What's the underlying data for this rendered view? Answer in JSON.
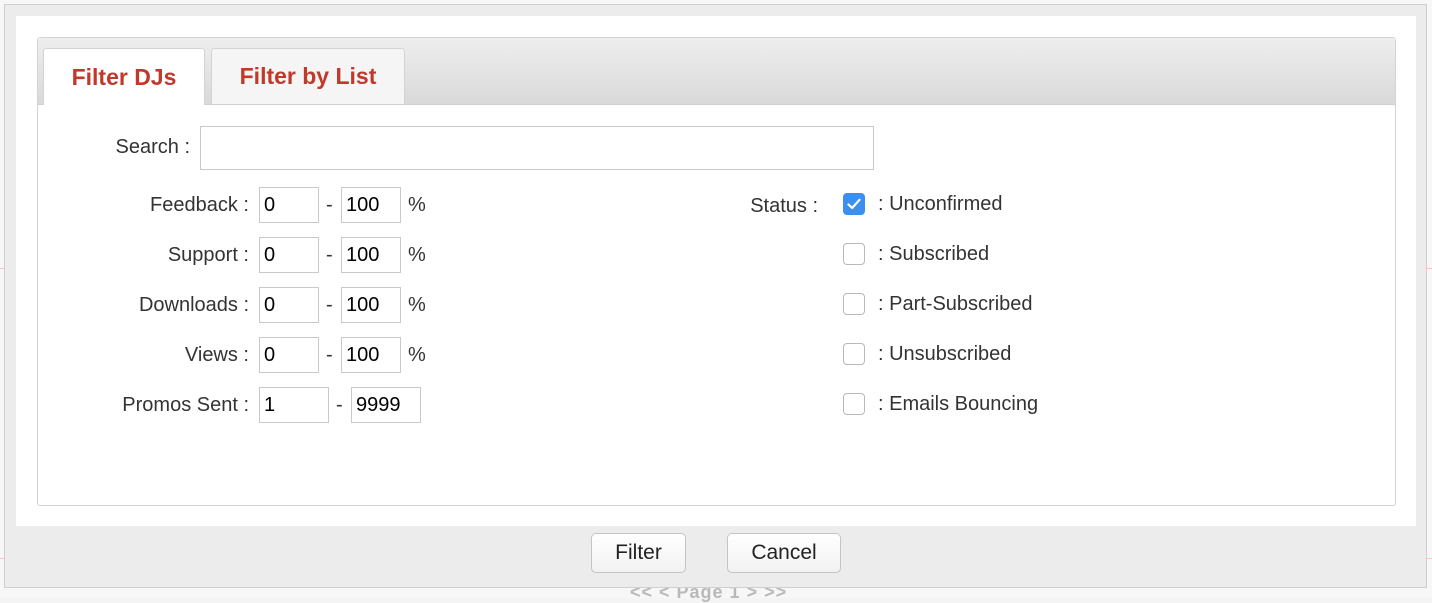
{
  "background": {
    "pagination": "<< < Page 1 > >>"
  },
  "tabs": [
    {
      "label": "Filter DJs",
      "active": true
    },
    {
      "label": "Filter by List",
      "active": false
    }
  ],
  "form": {
    "search": {
      "label": "Search :",
      "value": ""
    },
    "ranges": [
      {
        "label": "Feedback :",
        "min": "0",
        "max": "100",
        "unit": "%"
      },
      {
        "label": "Support :",
        "min": "0",
        "max": "100",
        "unit": "%"
      },
      {
        "label": "Downloads :",
        "min": "0",
        "max": "100",
        "unit": "%"
      },
      {
        "label": "Views :",
        "min": "0",
        "max": "100",
        "unit": "%"
      },
      {
        "label": "Promos Sent :",
        "min": "1",
        "max": "9999",
        "unit": ""
      }
    ],
    "dash": "-",
    "status": {
      "label": "Status :",
      "options": [
        {
          "label": ": Unconfirmed",
          "checked": true
        },
        {
          "label": ": Subscribed",
          "checked": false
        },
        {
          "label": ": Part-Subscribed",
          "checked": false
        },
        {
          "label": ": Unsubscribed",
          "checked": false
        },
        {
          "label": ": Emails Bouncing",
          "checked": false
        }
      ]
    }
  },
  "buttons": {
    "filter": "Filter",
    "cancel": "Cancel"
  },
  "colors": {
    "tab_text": "#c0392b",
    "checkbox_checked": "#3b8ff0"
  }
}
